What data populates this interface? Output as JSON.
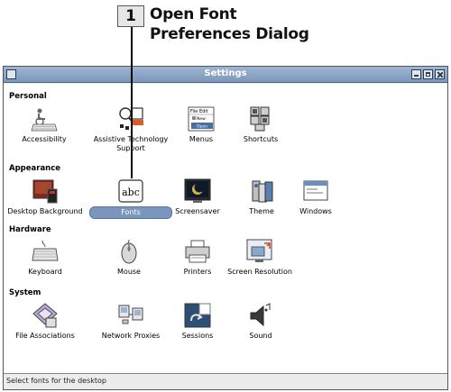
{
  "callout": {
    "number": "1",
    "line1": "Open Font",
    "line2": "Preferences Dialog"
  },
  "window": {
    "title": "Settings"
  },
  "sections": {
    "personal": {
      "title": "Personal",
      "items": [
        {
          "label": "Accessibility",
          "icon": "keyboard-wheelchair-icon"
        },
        {
          "label": "Assistive Technology Support",
          "icon": "assistive-technology-icon"
        },
        {
          "label": "Menus",
          "icon": "menus-icon",
          "menu_lines": [
            "File Edit",
            "New",
            "Open"
          ]
        },
        {
          "label": "Shortcuts",
          "icon": "shortcuts-icon"
        }
      ]
    },
    "appearance": {
      "title": "Appearance",
      "items": [
        {
          "label": "Desktop Background",
          "icon": "desktop-background-icon"
        },
        {
          "label": "Fonts",
          "icon": "fonts-icon",
          "selected": true,
          "glyph": "abc"
        },
        {
          "label": "Screensaver",
          "icon": "screensaver-icon"
        },
        {
          "label": "Theme",
          "icon": "theme-icon"
        },
        {
          "label": "Windows",
          "icon": "windows-icon"
        }
      ]
    },
    "hardware": {
      "title": "Hardware",
      "items": [
        {
          "label": "Keyboard",
          "icon": "keyboard-icon"
        },
        {
          "label": "Mouse",
          "icon": "mouse-icon"
        },
        {
          "label": "Printers",
          "icon": "printer-icon"
        },
        {
          "label": "Screen Resolution",
          "icon": "screen-resolution-icon"
        }
      ]
    },
    "system": {
      "title": "System",
      "items": [
        {
          "label": "File Associations",
          "icon": "file-associations-icon"
        },
        {
          "label": "Network Proxies",
          "icon": "network-proxies-icon"
        },
        {
          "label": "Sessions",
          "icon": "sessions-icon"
        },
        {
          "label": "Sound",
          "icon": "sound-icon"
        }
      ]
    }
  },
  "status": {
    "text": "Select fonts for the desktop"
  }
}
